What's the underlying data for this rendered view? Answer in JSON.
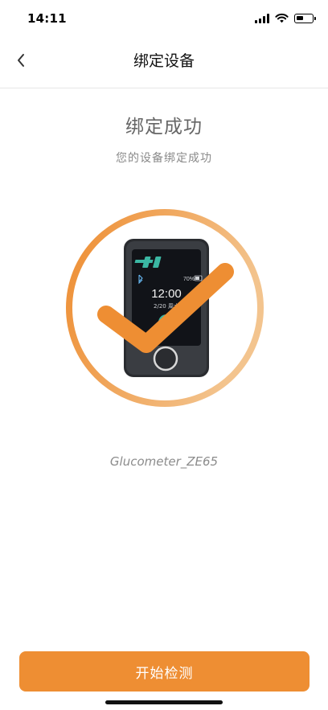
{
  "status_bar": {
    "time": "14:11"
  },
  "nav": {
    "title": "绑定设备",
    "back_icon": "chevron-left-icon"
  },
  "result": {
    "title": "绑定成功",
    "subtitle": "您的设备绑定成功"
  },
  "device_screen": {
    "battery_percent": "70%",
    "time": "12:00",
    "date": "2/20 周六"
  },
  "device": {
    "name": "Glucometer_ZE65"
  },
  "actions": {
    "start_label": "开始检测"
  },
  "colors": {
    "accent": "#EE8E33",
    "accent_light": "#F3BE82",
    "device_body": "#2a2c30",
    "screen": "#111318",
    "teal": "#3BB7A3"
  }
}
